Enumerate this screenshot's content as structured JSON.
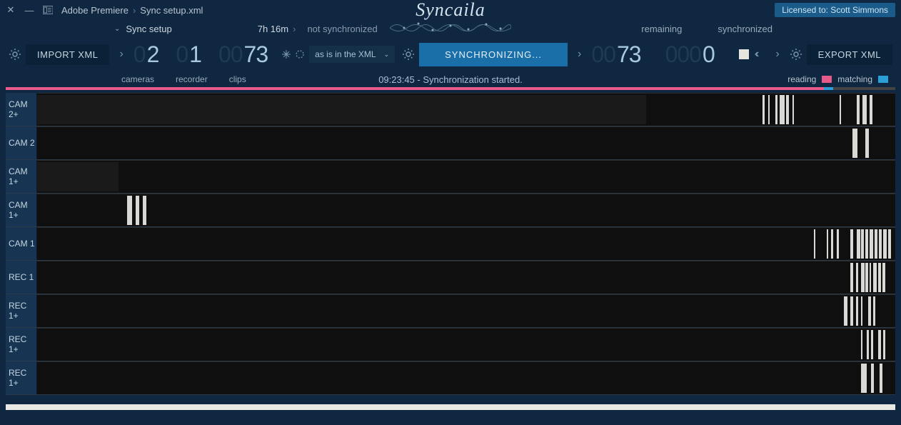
{
  "titlebar": {
    "app": "Adobe Premiere",
    "file": "Sync setup.xml",
    "logo": "Syncaila",
    "license": "Licensed to: Scott Simmons"
  },
  "subbar": {
    "project": "Sync setup",
    "duration": "7h 16m",
    "status": "not synchronized",
    "remaining_label": "remaining",
    "synchronized_label": "synchronized"
  },
  "toolbar": {
    "import_label": "IMPORT XML",
    "export_label": "EXPORT XML",
    "sync_label": "SYNCHRONIZING...",
    "dropdown_value": "as is in the XML",
    "cameras_count": "2",
    "recorder_count": "1",
    "clips_count": "73",
    "remaining_count": "73",
    "synchronized_count": "0"
  },
  "legend": {
    "cameras_label": "cameras",
    "recorder_label": "recorder",
    "clips_label": "clips",
    "status_msg": "09:23:45 - Synchronization started.",
    "reading_label": "reading",
    "matching_label": "matching"
  },
  "progress": {
    "pink_pct": 92,
    "blue_pct": 1
  },
  "tracks": [
    {
      "label": "CAM 2+",
      "clips": [
        {
          "l": 0,
          "w": 71,
          "dark": true
        },
        {
          "l": 84.5,
          "w": 0.3
        },
        {
          "l": 85.2,
          "w": 0.2
        },
        {
          "l": 86,
          "w": 0.3
        },
        {
          "l": 86.5,
          "w": 0.6
        },
        {
          "l": 87.3,
          "w": 0.3
        },
        {
          "l": 88,
          "w": 0.2
        },
        {
          "l": 93.5,
          "w": 0.2
        },
        {
          "l": 95.5,
          "w": 0.3
        },
        {
          "l": 96.2,
          "w": 0.5
        },
        {
          "l": 97,
          "w": 0.3
        }
      ]
    },
    {
      "label": "CAM 2",
      "clips": [
        {
          "l": 95,
          "w": 0.6
        },
        {
          "l": 96.5,
          "w": 0.4
        }
      ]
    },
    {
      "label": "CAM 1+",
      "clips": [
        {
          "l": 0,
          "w": 9.5,
          "dark": true
        }
      ]
    },
    {
      "label": "CAM 1+",
      "clips": [
        {
          "l": 10.5,
          "w": 0.6
        },
        {
          "l": 11.5,
          "w": 0.4
        },
        {
          "l": 12.3,
          "w": 0.4
        }
      ]
    },
    {
      "label": "CAM 1",
      "clips": [
        {
          "l": 90.5,
          "w": 0.2
        },
        {
          "l": 92,
          "w": 0.2
        },
        {
          "l": 92.5,
          "w": 0.3
        },
        {
          "l": 93.2,
          "w": 0.2
        },
        {
          "l": 94.8,
          "w": 0.3
        },
        {
          "l": 95.5,
          "w": 0.4
        },
        {
          "l": 96,
          "w": 0.3
        },
        {
          "l": 96.5,
          "w": 0.3
        },
        {
          "l": 97,
          "w": 0.4
        },
        {
          "l": 97.6,
          "w": 0.3
        },
        {
          "l": 98.1,
          "w": 0.3
        },
        {
          "l": 98.6,
          "w": 0.4
        },
        {
          "l": 99.2,
          "w": 0.3
        }
      ]
    },
    {
      "label": "REC 1",
      "clips": [
        {
          "l": 94.8,
          "w": 0.3
        },
        {
          "l": 95.4,
          "w": 0.3
        },
        {
          "l": 96,
          "w": 0.4
        },
        {
          "l": 96.5,
          "w": 0.3
        },
        {
          "l": 97,
          "w": 0.2
        },
        {
          "l": 97.4,
          "w": 0.4
        },
        {
          "l": 98,
          "w": 0.3
        },
        {
          "l": 98.5,
          "w": 0.3
        }
      ]
    },
    {
      "label": "REC 1+",
      "clips": [
        {
          "l": 94,
          "w": 0.4
        },
        {
          "l": 94.8,
          "w": 0.3
        },
        {
          "l": 95.4,
          "w": 0.3
        },
        {
          "l": 96,
          "w": 0.2
        },
        {
          "l": 96.8,
          "w": 0.4
        },
        {
          "l": 97.4,
          "w": 0.3
        }
      ]
    },
    {
      "label": "REC 1+",
      "clips": [
        {
          "l": 96,
          "w": 0.2
        },
        {
          "l": 96.7,
          "w": 0.2
        },
        {
          "l": 97.2,
          "w": 0.2
        },
        {
          "l": 98,
          "w": 0.3
        },
        {
          "l": 98.6,
          "w": 0.2
        }
      ]
    },
    {
      "label": "REC 1+",
      "clips": [
        {
          "l": 96,
          "w": 0.7
        },
        {
          "l": 97.2,
          "w": 0.3
        },
        {
          "l": 98.2,
          "w": 0.3
        }
      ]
    }
  ]
}
